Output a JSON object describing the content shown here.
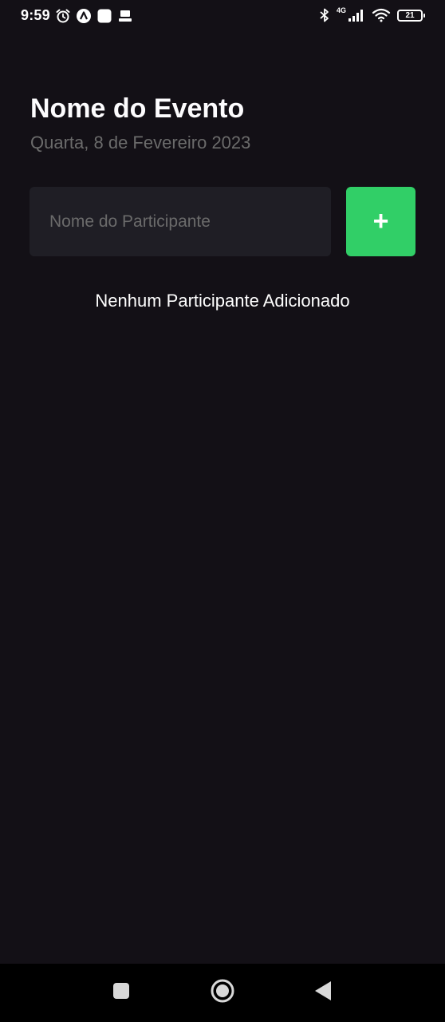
{
  "status_bar": {
    "time": "9:59",
    "network": "4G",
    "battery": "21",
    "icons_left": [
      "alarm-icon",
      "app-a-icon",
      "square-app-icon",
      "laptop-icon"
    ],
    "icons_right": [
      "bluetooth-icon",
      "signal-icon",
      "wifi-icon",
      "battery-icon"
    ]
  },
  "header": {
    "title": "Nome do Evento",
    "date": "Quarta, 8 de Fevereiro 2023"
  },
  "form": {
    "placeholder": "Nome do Participante",
    "value": "",
    "add_label": "+"
  },
  "list": {
    "empty_message": "Nenhum Participante Adicionado"
  },
  "nav_bar": {
    "buttons": [
      "recents-icon",
      "home-icon",
      "back-icon"
    ]
  },
  "colors": {
    "background": "#131016",
    "input_background": "#1F1E25",
    "accent": "#31CF67",
    "muted_text": "#6B6B6B",
    "text": "#FDFCFE"
  }
}
